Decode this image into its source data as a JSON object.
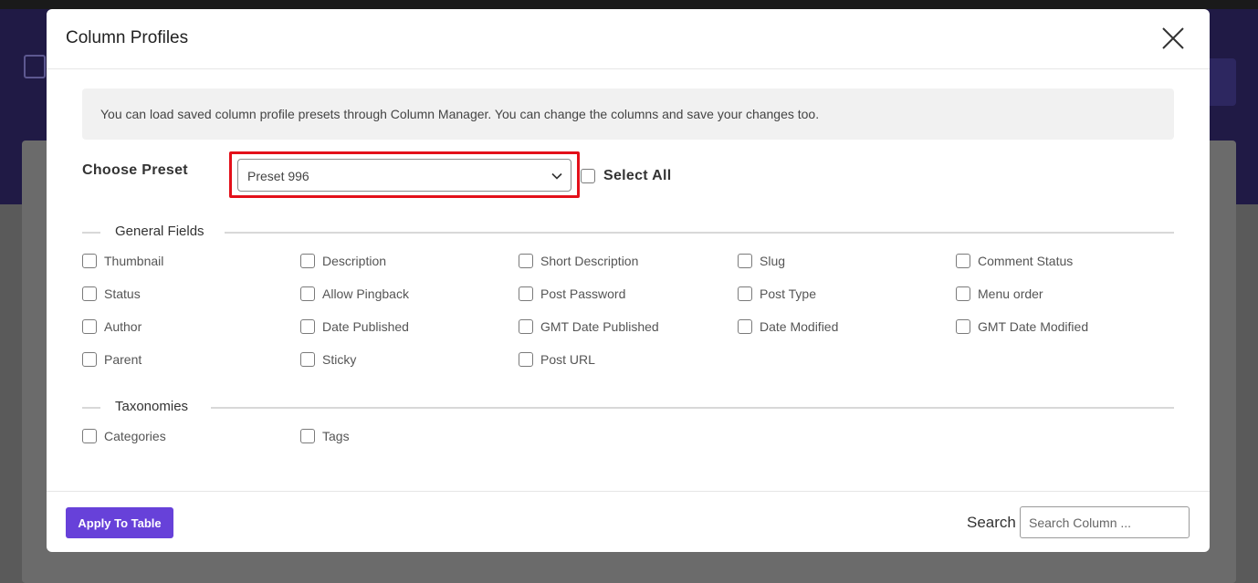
{
  "modal": {
    "title": "Column Profiles",
    "info": "You can load saved column profile presets through Column Manager. You can change the columns and save your changes too.",
    "preset": {
      "label": "Choose Preset",
      "selected": "Preset 996"
    },
    "select_all_label": "Select All",
    "sections": {
      "general": {
        "title": "General Fields",
        "fields": [
          "Thumbnail",
          "Description",
          "Short Description",
          "Slug",
          "Comment Status",
          "Status",
          "Allow Pingback",
          "Post Password",
          "Post Type",
          "Menu order",
          "Author",
          "Date Published",
          "GMT Date Published",
          "Date Modified",
          "GMT Date Modified",
          "Parent",
          "Sticky",
          "Post URL"
        ]
      },
      "taxonomies": {
        "title": "Taxonomies",
        "fields": [
          "Categories",
          "Tags"
        ]
      }
    },
    "footer": {
      "apply_label": "Apply To Table",
      "search_label": "Search",
      "search_placeholder": "Search Column ..."
    }
  },
  "colors": {
    "accent": "#6741d9",
    "highlight": "#e3101a",
    "header_bg": "#201a45"
  },
  "icons": {
    "close": "close-icon",
    "dropdown": "chevron-down-icon"
  }
}
